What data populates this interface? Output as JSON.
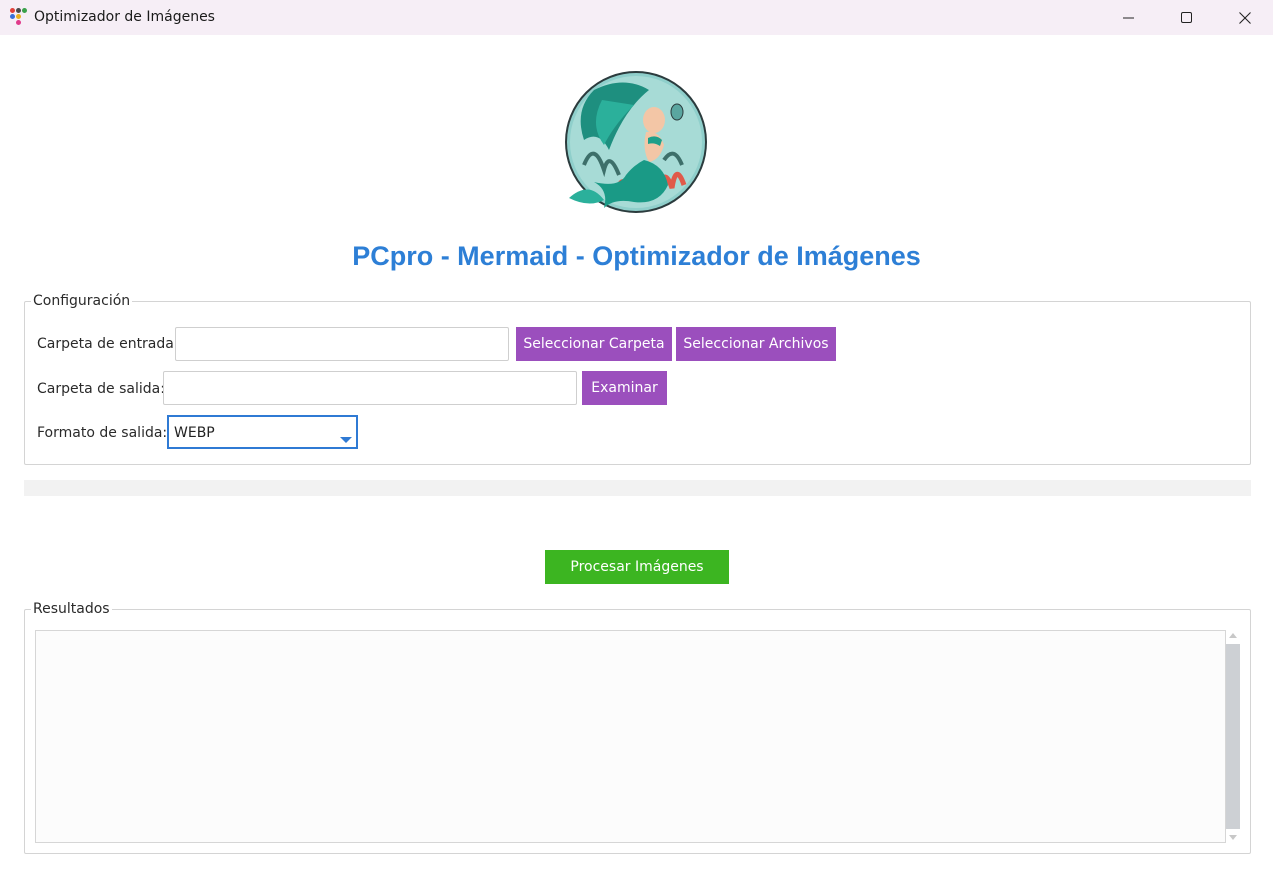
{
  "window": {
    "title": "Optimizador de Imágenes",
    "icon": "app-dots-icon",
    "controls": [
      "minimize-icon",
      "maximize-icon",
      "close-icon"
    ]
  },
  "header": {
    "logo": "mermaid-logo",
    "title": "PCpro - Mermaid - Optimizador de Imágenes"
  },
  "config": {
    "legend": "Configuración",
    "input_folder": {
      "label": "Carpeta de entrada:",
      "value": "",
      "select_folder_button": "Seleccionar Carpeta",
      "select_files_button": "Seleccionar Archivos"
    },
    "output_folder": {
      "label": "Carpeta de salida:",
      "value": "",
      "browse_button": "Examinar"
    },
    "output_format": {
      "label": "Formato de salida:",
      "selected": "WEBP"
    }
  },
  "progress": {
    "value": 0
  },
  "process_button": "Procesar Imágenes",
  "results": {
    "legend": "Resultados",
    "text": ""
  },
  "colors": {
    "accent_title": "#2d7fd6",
    "purple_button": "#9b4fbd",
    "green_button": "#3cb521",
    "focus_border": "#2f7ad4",
    "titlebar": "#f6eef6"
  }
}
